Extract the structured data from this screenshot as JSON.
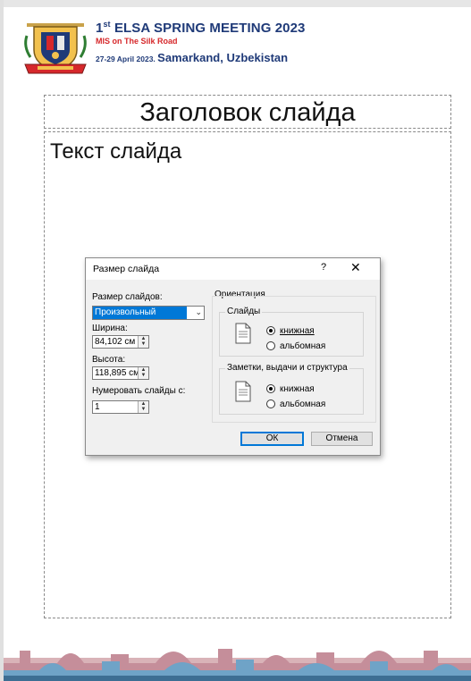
{
  "header": {
    "title_prefix": "1",
    "title_sup": "st",
    "title_main": "ELSA SPRING MEETING 2023",
    "subtitle": "MIS on The Silk Road",
    "dates": "27-29 April 2023.",
    "location": "Samarkand, Uzbekistan"
  },
  "slide": {
    "title_placeholder": "Заголовок слайда",
    "body_placeholder": "Текст слайда"
  },
  "dialog": {
    "title": "Размер слайда",
    "help": "?",
    "close": "✕",
    "size_label": "Размер слайдов:",
    "size_value": "Произвольный",
    "width_label": "Ширина:",
    "width_value": "84,102 см",
    "height_label": "Высота:",
    "height_value": "118,895 см",
    "number_from_label": "Нумеровать слайды с:",
    "number_from_value": "1",
    "orientation_label": "Ориентация",
    "slides_group": "Слайды",
    "slides_portrait": "книжная",
    "slides_landscape": "альбомная",
    "notes_group": "Заметки, выдачи и структура",
    "notes_portrait": "книжная",
    "notes_landscape": "альбомная",
    "ok": "ОК",
    "cancel": "Отмена"
  },
  "colors": {
    "brand_blue": "#1f3a78",
    "brand_red": "#d6282b",
    "selection": "#0078d7"
  }
}
